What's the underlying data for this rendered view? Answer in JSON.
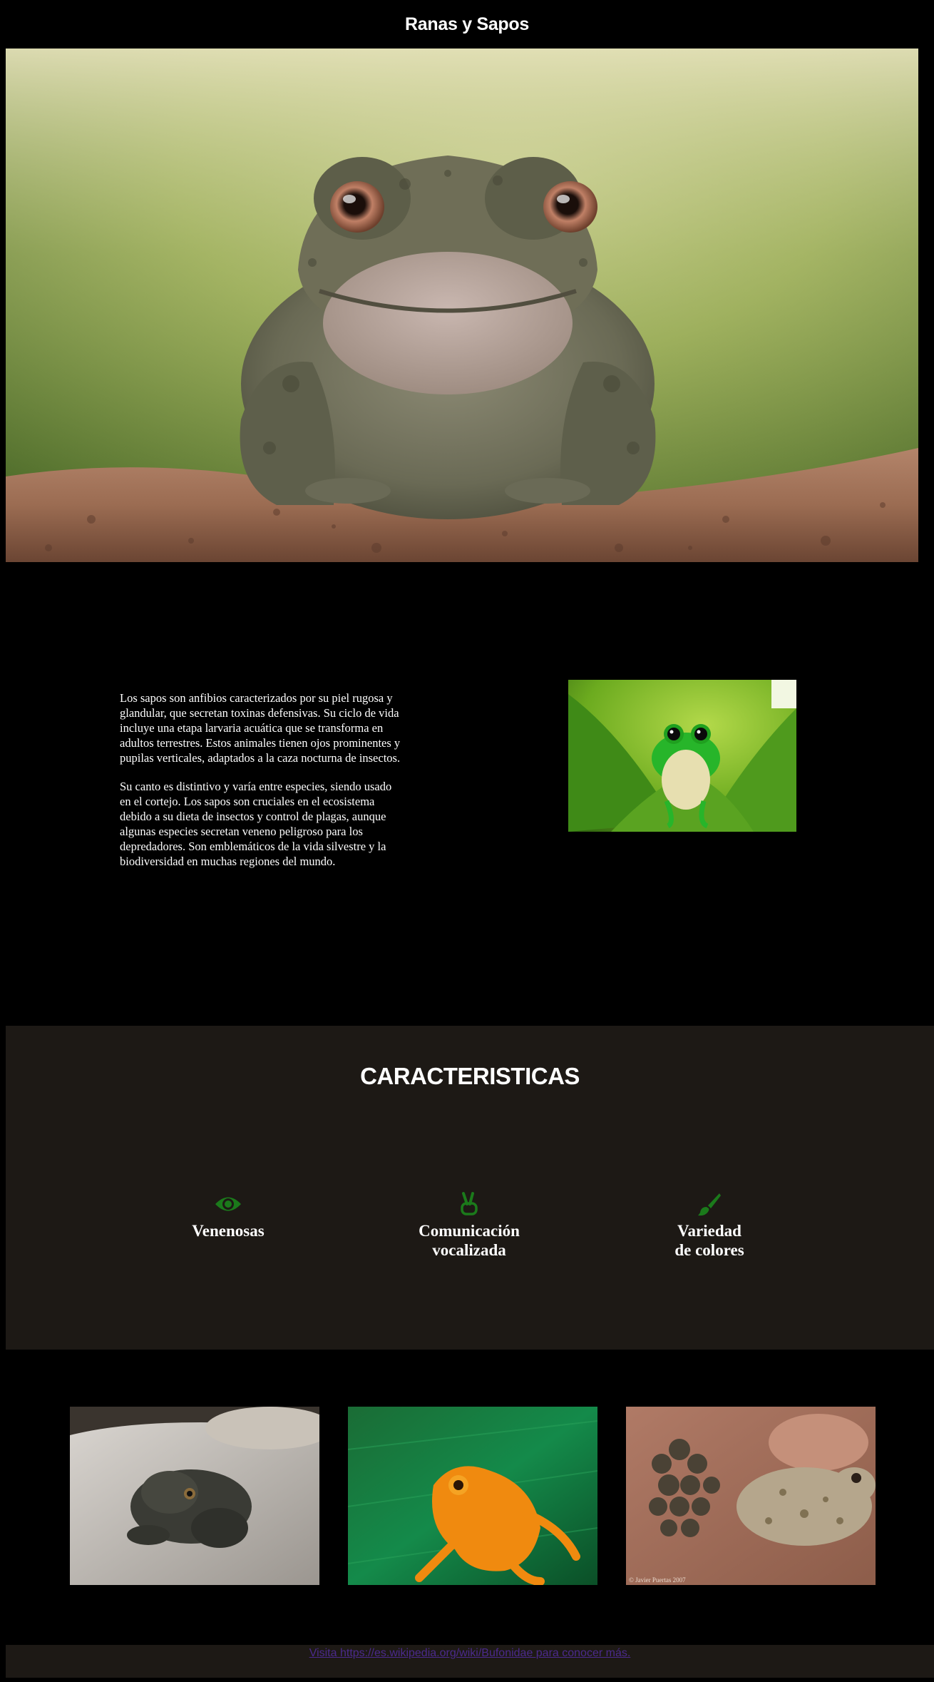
{
  "header": {
    "title": "Ranas y Sapos"
  },
  "intro": {
    "paragraphs": [
      "Los sapos son anfibios caracterizados por su piel rugosa y glandular, que secretan toxinas defensivas. Su ciclo de vida incluye una etapa larvaria acuática que se transforma en adultos terrestres. Estos animales tienen ojos prominentes y pupilas verticales, adaptados a la caza nocturna de insectos.",
      "Su canto es distintivo y varía entre especies, siendo usado en el cortejo. Los sapos son cruciales en el ecosistema debido a su dieta de insectos y control de plagas, aunque algunas especies secretan veneno peligroso para los depredadores. Son emblemáticos de la vida silvestre y la biodiversidad en muchas regiones del mundo."
    ]
  },
  "features": {
    "title": "CARACTERISTICAS",
    "accent": "#1b7a1b",
    "items": [
      {
        "icon": "eye-icon",
        "label_line1": "Venenosas",
        "label_line2": ""
      },
      {
        "icon": "peace-hand-icon",
        "label_line1": "Comunicación",
        "label_line2": "vocalizada"
      },
      {
        "icon": "paintbrush-icon",
        "label_line1": "Variedad",
        "label_line2": "de colores"
      }
    ]
  },
  "gallery": {
    "photo_credit": "© Javier Puertas 2007"
  },
  "footer": {
    "link_text": "Visita https://es.wikipedia.org/wiki/Bufonidae para conocer más."
  }
}
